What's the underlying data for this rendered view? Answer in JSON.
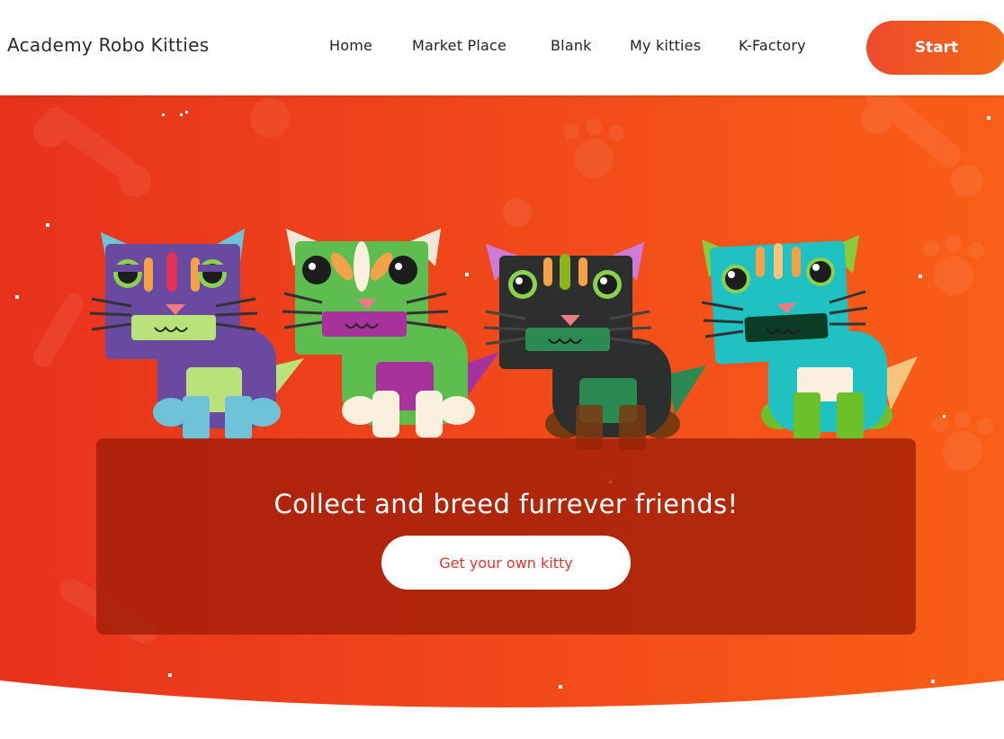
{
  "header": {
    "brand": "Academy Robo Kitties",
    "nav": [
      {
        "label": "Home"
      },
      {
        "label": "Market Place"
      },
      {
        "label": "Blank"
      },
      {
        "label": "My kitties"
      },
      {
        "label": "K-Factory"
      }
    ],
    "start_label": "Start"
  },
  "hero": {
    "tagline": "Collect and breed furrever friends!",
    "cta_label": "Get your own kitty",
    "kitties": [
      {
        "body": "#6a4aa0",
        "accent": "#b9e37a",
        "ear_inner": "#6ec3d8",
        "stripe": "#f3a24a",
        "paw": "#6ec3d8"
      },
      {
        "body": "#5dbd4f",
        "accent": "#a8329b",
        "ear_inner": "#f2e6d8",
        "stripe": "#f3a24a",
        "paw": "#fbefdd"
      },
      {
        "body": "#2c2f2e",
        "accent": "#2a8a52",
        "ear_inner": "#cf7ad6",
        "stripe": "#f3a24a",
        "paw": "#7a3a10"
      },
      {
        "body": "#1fc1c3",
        "accent": "#0b3d25",
        "ear_inner": "#8acb3a",
        "stripe": "#f3a24a",
        "paw": "#6cc12a"
      }
    ],
    "colors": {
      "hero_start": "#e8321c",
      "hero_end": "#f95f18",
      "panel": "#a81d08"
    }
  }
}
